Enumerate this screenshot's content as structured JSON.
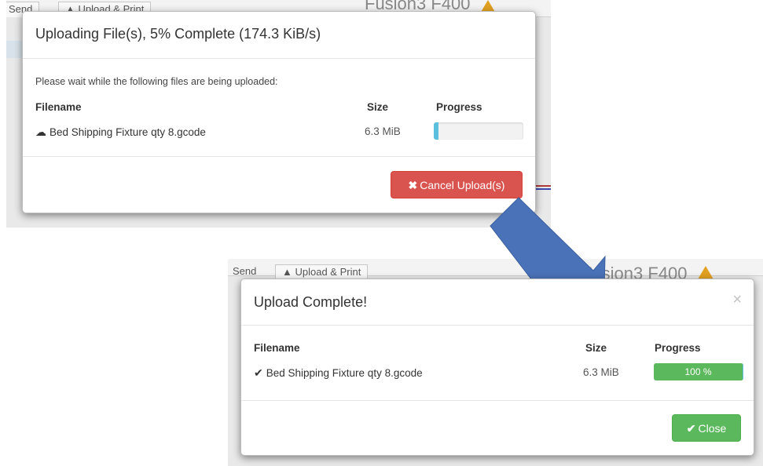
{
  "background_top": {
    "tabs": [
      "Send",
      "Upload & Print"
    ],
    "title": "Fusion3 F400"
  },
  "background_bottom": {
    "tabs": [
      "Send",
      "Upload & Print"
    ],
    "title": "Fusion3 F400"
  },
  "uploading_dialog": {
    "title": "Uploading File(s), 5% Complete (174.3 KiB/s)",
    "message": "Please wait while the following files are being uploaded:",
    "columns": {
      "filename": "Filename",
      "size": "Size",
      "progress": "Progress"
    },
    "file": {
      "name": "Bed Shipping Fixture qty 8.gcode",
      "size": "6.3 MiB",
      "icon": "upload-cloud-icon",
      "progress_fraction": 0.05
    },
    "cancel_button": {
      "icon": "✖",
      "label": "Cancel Upload(s)"
    }
  },
  "complete_dialog": {
    "title": "Upload Complete!",
    "close_icon": "×",
    "columns": {
      "filename": "Filename",
      "size": "Size",
      "progress": "Progress"
    },
    "file": {
      "name": "Bed Shipping Fixture qty 8.gcode",
      "size": "6.3 MiB",
      "icon": "checkmark-icon",
      "progress_fraction": 1.0,
      "progress_label": "100 %"
    },
    "close_button": {
      "icon": "✔",
      "label": "Close"
    }
  },
  "colors": {
    "arrow": "#4a72b8",
    "danger": "#d9534f",
    "success": "#5cb85c",
    "info": "#5bc0de"
  }
}
